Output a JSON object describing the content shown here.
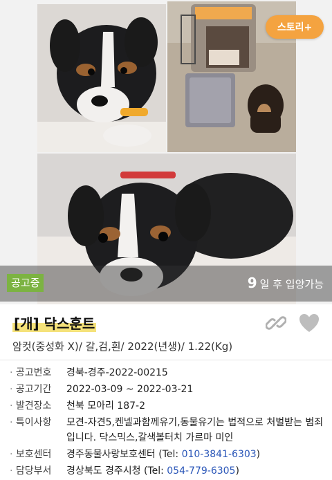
{
  "story_button": {
    "label": "스토리+"
  },
  "status": {
    "badge": "공고중",
    "days": "9",
    "days_text": "일 후 입양가능"
  },
  "title": {
    "tag": "[개]",
    "breed": "닥스훈트"
  },
  "summary": "암컷(중성화 X)/ 갈,검,흰/ 2022(년생)/ 1.22(Kg)",
  "details": [
    {
      "key": "공고번호",
      "value": "경북-경주-2022-00215"
    },
    {
      "key": "공고기간",
      "value": "2022-03-09 ~ 2022-03-21"
    },
    {
      "key": "발견장소",
      "value": "천북 모아리 187-2"
    },
    {
      "key": "특이사항",
      "value": "모견-자견5,켄넬과함께유기,동물유기는 법적으로 처벌받는 범죄입니다. 닥스믹스,갈색볼터치 가르마 미인"
    },
    {
      "key": "보호센터",
      "value": "경주동물사랑보호센터",
      "tel_prefix": "(Tel: ",
      "tel": "010-3841-6303",
      "tel_suffix": ")"
    },
    {
      "key": "담당부서",
      "value": "경상북도 경주시청",
      "tel_prefix": "(Tel: ",
      "tel": "054-779-6305",
      "tel_suffix": ")"
    }
  ],
  "icons": {
    "link": "link-icon",
    "favorite": "heart-icon"
  },
  "colors": {
    "accent": "#f4a340",
    "badge": "#7cb342",
    "highlight": "#f5e27a",
    "id_text": "#e07a2e",
    "tel_text": "#2a56b8"
  }
}
